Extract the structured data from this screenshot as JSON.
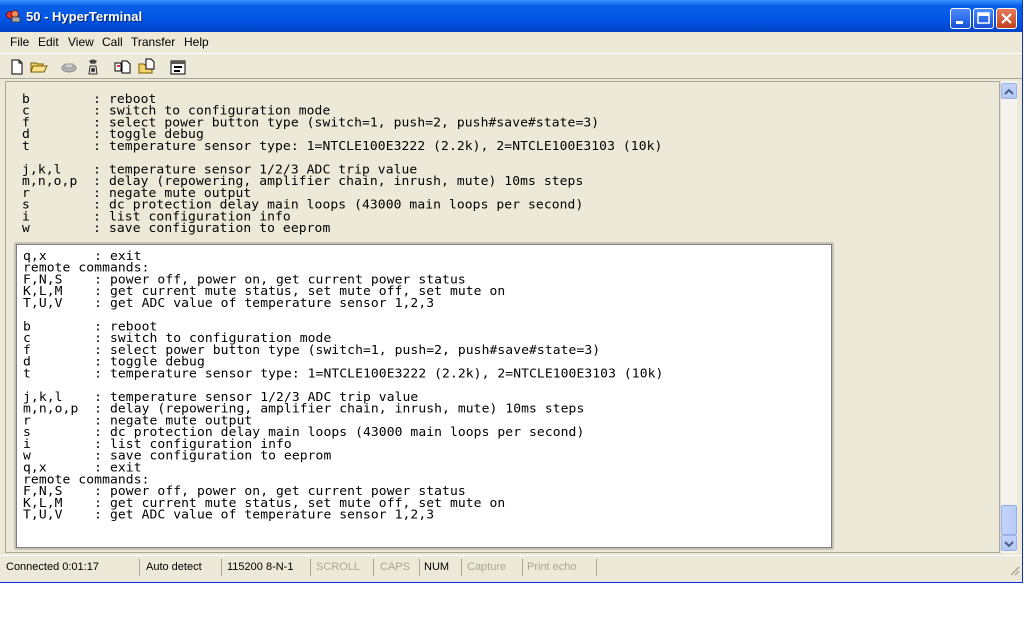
{
  "window": {
    "title": "50 - HyperTerminal",
    "colors": {
      "titlebar": "#0055e5",
      "chrome": "#ece9d8",
      "terminal_bg": "#ffffff"
    }
  },
  "menu": [
    "File",
    "Edit",
    "View",
    "Call",
    "Transfer",
    "Help"
  ],
  "toolbar": {
    "icons": [
      "new-document-icon",
      "open-folder-icon",
      "phone-dial-icon",
      "phone-hangup-icon",
      "send-file-icon",
      "receive-file-icon",
      "properties-icon"
    ]
  },
  "terminal": {
    "background_text": "b        : reboot\nc        : switch to configuration mode\nf        : select power button type (switch=1, push=2, push#save#state=3)\nd        : toggle debug\nt        : temperature sensor type: 1=NTCLE100E3222 (2.2k), 2=NTCLE100E3103 (10k)\n\nj,k,l    : temperature sensor 1/2/3 ADC trip value\nm,n,o,p  : delay (repowering, amplifier chain, inrush, mute) 10ms steps\nr        : negate mute output\ns        : dc protection delay main loops (43000 main loops per second)\ni        : list configuration info\nw        : save configuration to eeprom",
    "overlay_text": "q,x      : exit\nremote commands:\nF,N,S    : power off, power on, get current power status\nK,L,M    : get current mute status, set mute off, set mute on\nT,U,V    : get ADC value of temperature sensor 1,2,3\n\nb        : reboot\nc        : switch to configuration mode\nf        : select power button type (switch=1, push=2, push#save#state=3)\nd        : toggle debug\nt        : temperature sensor type: 1=NTCLE100E3222 (2.2k), 2=NTCLE100E3103 (10k)\n\nj,k,l    : temperature sensor 1/2/3 ADC trip value\nm,n,o,p  : delay (repowering, amplifier chain, inrush, mute) 10ms steps\nr        : negate mute output\ns        : dc protection delay main loops (43000 main loops per second)\ni        : list configuration info\nw        : save configuration to eeprom\nq,x      : exit\nremote commands:\nF,N,S    : power off, power on, get current power status\nK,L,M    : get current mute status, set mute off, set mute on\nT,U,V    : get ADC value of temperature sensor 1,2,3"
  },
  "status": {
    "connected": "Connected 0:01:17",
    "detect": "Auto detect",
    "port": "115200 8-N-1",
    "scroll": "SCROLL",
    "caps": "CAPS",
    "num": "NUM",
    "capture": "Capture",
    "print_echo": "Print echo"
  }
}
